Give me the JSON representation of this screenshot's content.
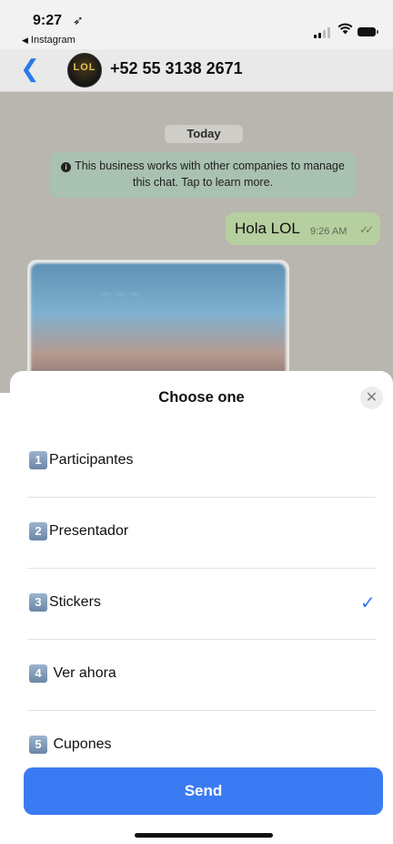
{
  "status_bar": {
    "time": "9:27",
    "location_icon": "location-arrow-icon",
    "back_app": "Instagram"
  },
  "chat": {
    "contact_name": "+52 55 3138 2671",
    "avatar_text": "LOL",
    "date_label": "Today",
    "system_note": "This business works with other companies to manage this chat. Tap to learn more.",
    "outgoing_message": {
      "text": "Hola LOL",
      "time": "9:26 AM"
    }
  },
  "sheet": {
    "title": "Choose one",
    "options": [
      {
        "number": "1",
        "label": "Participantes",
        "selected": false
      },
      {
        "number": "2",
        "label": "Presentador",
        "selected": false
      },
      {
        "number": "3",
        "label": "Stickers",
        "selected": true
      },
      {
        "number": "4",
        "label": " Ver ahora",
        "selected": false
      },
      {
        "number": "5",
        "label": " Cupones",
        "selected": false
      }
    ],
    "send_label": "Send"
  },
  "colors": {
    "accent": "#3a7bf3",
    "outgoing_bubble": "#b6cf9f",
    "system_note_bg": "#a9c1b1"
  }
}
